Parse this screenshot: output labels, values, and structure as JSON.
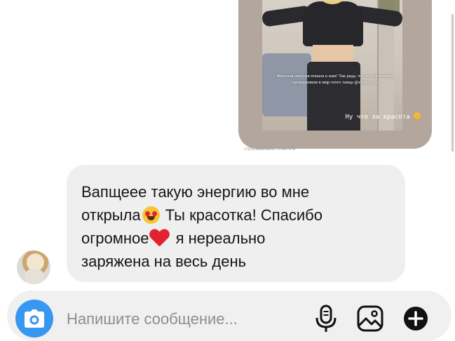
{
  "story": {
    "caption": "Женская энергия попала к нам! Так рада, что ты стала моим проводником в мир этого танца @elmira__lu",
    "footer_text": "Ну что за красота",
    "footer_emoji": "smiling-face-emoji",
    "sub_caption": "стать нажимать...ответить"
  },
  "message": {
    "line1": "Вапщеее такую энергию во мне",
    "line2a": "открыла",
    "line2b": "Ты красотка! Спасибо",
    "line3a": "огромное",
    "line3b": "я нереально",
    "line4": "заряжена на весь день",
    "emoji_1": "heart-eyes-emoji",
    "emoji_2": "red-heart-emoji"
  },
  "composer": {
    "placeholder": "Напишите сообщение...",
    "icons": [
      "camera-icon",
      "microphone-icon",
      "gallery-icon",
      "plus-icon"
    ]
  },
  "colors": {
    "accent": "#3897f0",
    "bubble_bg": "#efefef",
    "composer_bg": "#f0f0f0",
    "heart": "#e3212f"
  }
}
